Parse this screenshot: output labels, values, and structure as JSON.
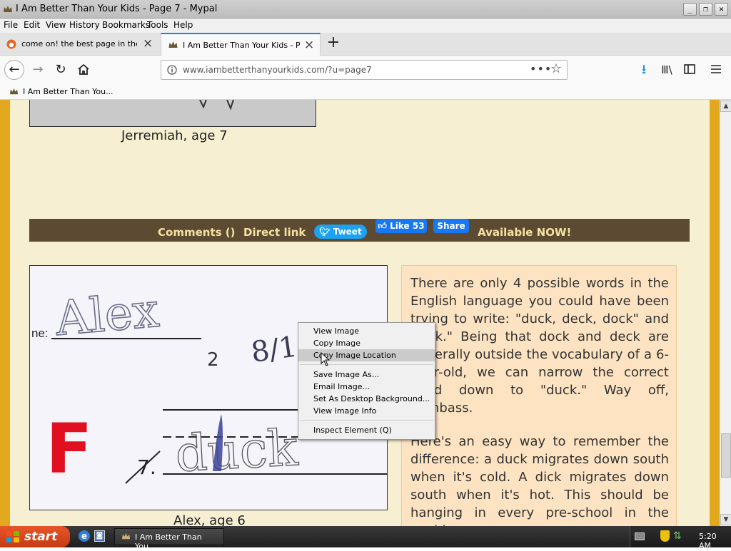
{
  "window": {
    "title": "I Am Better Than Your Kids - Page 7 - Mypal"
  },
  "menubar": [
    "File",
    "Edit",
    "View",
    "History",
    "Bookmarks",
    "Tools",
    "Help"
  ],
  "tabs": [
    {
      "label": "come on! the best page in the uni"
    },
    {
      "label": "I Am Better Than Your Kids - Page"
    }
  ],
  "address": {
    "url": "www.iambetterthanyourkids.com/?u=page7"
  },
  "bookmarks": [
    {
      "label": "I Am Better Than You..."
    }
  ],
  "content": {
    "caption_top": "Jerremiah, age 7",
    "sharebar": {
      "comments": "Comments ()",
      "direct_link": "Direct link",
      "tweet": "Tweet",
      "like": "Like 53",
      "share": "Share",
      "available": "Available NOW!"
    },
    "caption_photo": "Alex, age 6",
    "worksheet": {
      "name_label": "ne:",
      "name": "Alex",
      "date": "8/18",
      "grade": "F",
      "num1": "2",
      "num2": "7.",
      "answer": "duck"
    },
    "paragraph1": "There are only 4 possible words in the English language you could have been trying to write: \"duck, deck, dock\" and \"dick.\" Being that dock and deck are generally outside the vocabulary of a 6-year-old, we can narrow the correct word down to \"duck.\" Way off, dumbass.",
    "paragraph2": "Here's an easy way to remember the difference: a duck migrates down south when it's cold. A dick migrates down south when it's hot. This should be hanging in every pre-school in the world."
  },
  "context_menu": {
    "items": [
      {
        "label": "View Image"
      },
      {
        "label": "Copy Image"
      },
      {
        "label": "Copy Image Location"
      },
      {
        "label": "Save Image As..."
      },
      {
        "label": "Email Image..."
      },
      {
        "label": "Set As Desktop Background..."
      },
      {
        "label": "View Image Info"
      },
      {
        "label": "Inspect Element (Q)"
      }
    ],
    "highlighted_index": 2
  },
  "taskbar": {
    "start": "start",
    "item": "I Am Better Than You...",
    "clock": "5:20 AM"
  },
  "colors": {
    "accent": "#0a84ff",
    "page_bg": "#f6efd2",
    "border_gold": "#e2a91f",
    "sharebar": "#5c4a33",
    "textbox": "#fde3c1"
  }
}
